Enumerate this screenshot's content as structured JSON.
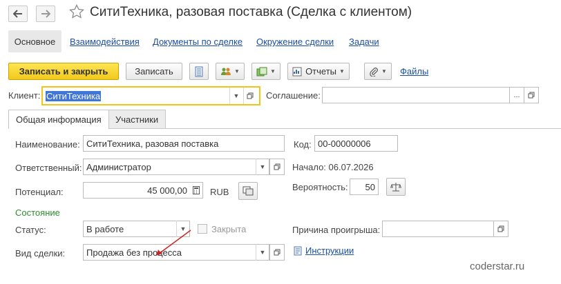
{
  "header": {
    "title": "СитиТехника, разовая поставка (Сделка с клиентом)",
    "back_icon": "arrow-left-icon",
    "forward_icon": "arrow-right-icon",
    "favorite_icon": "star-outline-icon"
  },
  "nav": {
    "tabs": [
      {
        "label": "Основное"
      },
      {
        "label": "Взаимодействия"
      },
      {
        "label": "Документы по сделке"
      },
      {
        "label": "Окружение сделки"
      },
      {
        "label": "Задачи"
      }
    ]
  },
  "toolbar": {
    "save_close": "Записать и закрыть",
    "save": "Записать",
    "reports": "Отчеты",
    "files": "Файлы"
  },
  "client": {
    "label": "Клиент:",
    "value": "СитиТехника"
  },
  "agreement": {
    "label": "Соглашение:",
    "value": "",
    "choose": "..."
  },
  "form_tabs": [
    {
      "label": "Общая информация"
    },
    {
      "label": "Участники"
    }
  ],
  "general": {
    "name_label": "Наименование:",
    "name_value": "СитиТехника, разовая поставка",
    "code_label": "Код:",
    "code_value": "00-00000006",
    "responsible_label": "Ответственный:",
    "responsible_value": "Администратор",
    "start_text": "Начало: 06.07.2026",
    "potential_label": "Потенциал:",
    "potential_value": "45 000,00",
    "currency": "RUB",
    "probability_label": "Вероятность:",
    "probability_value": "50"
  },
  "state": {
    "section_title": "Состояние",
    "status_label": "Статус:",
    "status_value": "В работе",
    "closed_label": "Закрыта",
    "closed_checked": false,
    "loss_reason_label": "Причина проигрыша:",
    "loss_reason_value": "",
    "deal_type_label": "Вид сделки:",
    "deal_type_value": "Продажа без процесса",
    "instructions": "Инструкции"
  },
  "watermark": "coderstar.ru",
  "colors": {
    "accent_yellow": "#f5d02a",
    "link_blue": "#1a4fa0",
    "section_green": "#2e8b2e",
    "annotation_red": "#cc2222",
    "selection_blue": "#3f76d8"
  }
}
